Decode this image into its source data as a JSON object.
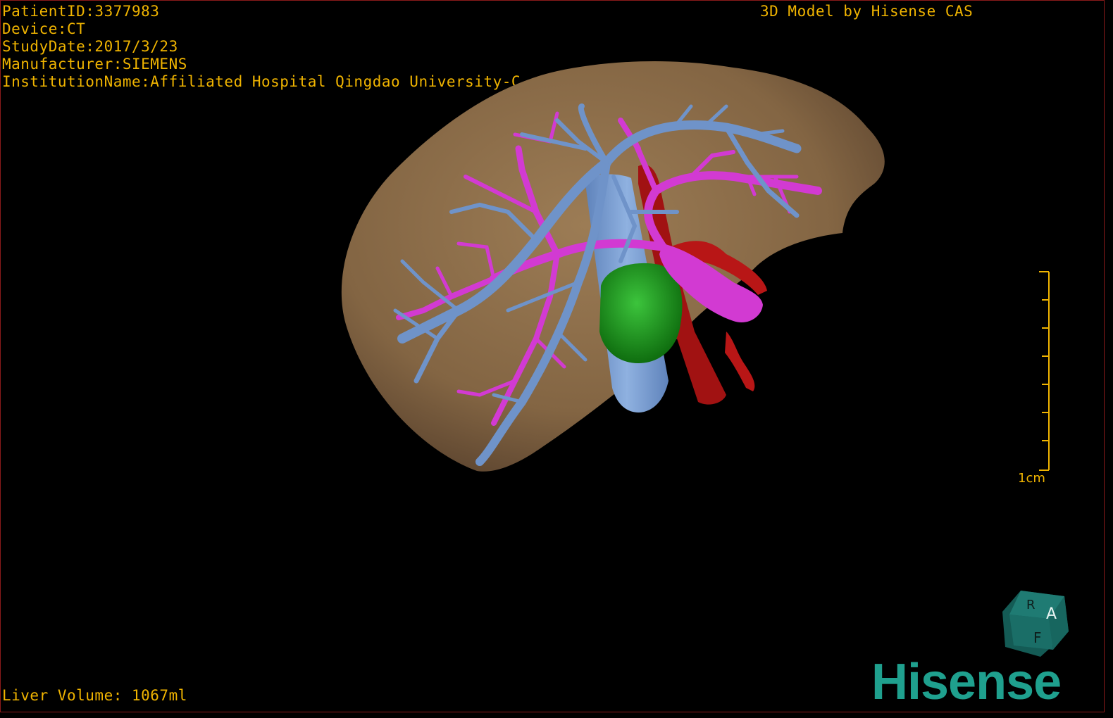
{
  "header": {
    "patient_id": "PatientID:3377983",
    "device": "Device:CT",
    "study_date": "StudyDate:2017/3/23",
    "manufacturer": "Manufacturer:SIEMENS",
    "institution": "InstitutionName:Affiliated Hospital Qingdao University-C"
  },
  "credit": "3D Model by Hisense CAS",
  "footer": {
    "liver_volume": "Liver Volume: 1067ml"
  },
  "scale_bar": {
    "label": "1cm"
  },
  "orientation_cube": {
    "faces": [
      "A",
      "R",
      "F"
    ],
    "color": "#1a6e67"
  },
  "brand": {
    "logo_text": "Hisense",
    "color": "#1fa08e"
  },
  "colors": {
    "text": "#f0b400",
    "liver": "#8a6c47",
    "hepatic_vein": "#6f93c9",
    "portal_vein": "#d634d6",
    "artery": "#b01010",
    "gallbladder": "#1c8c1c"
  }
}
